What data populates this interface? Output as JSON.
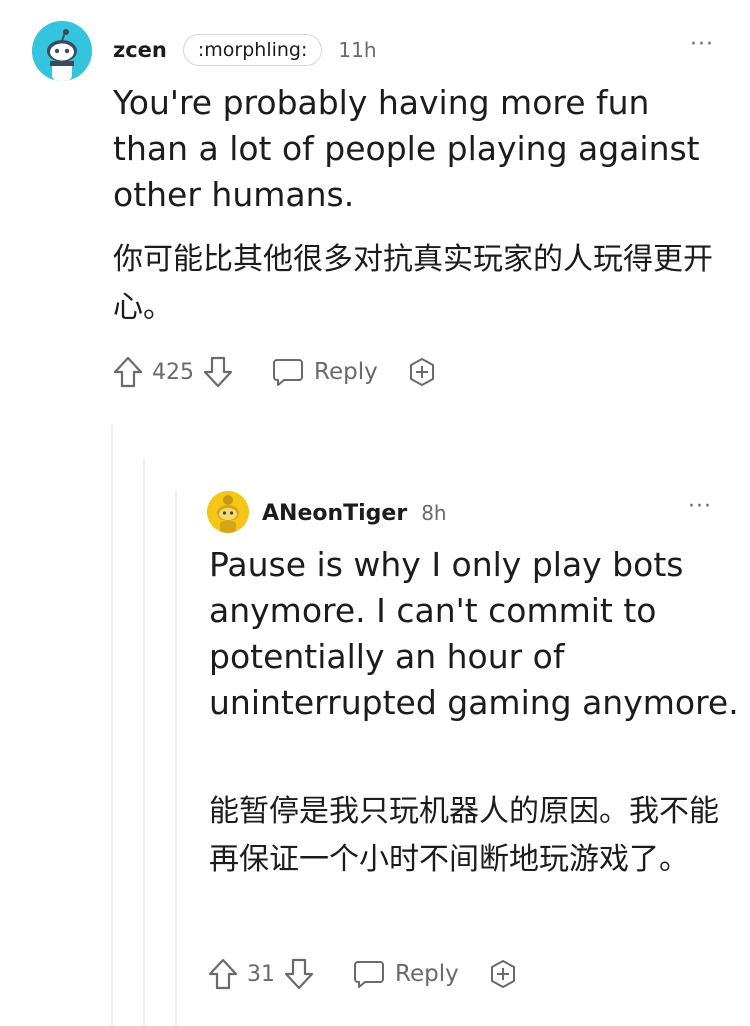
{
  "comments": [
    {
      "username": "zcen",
      "flair": ":morphling:",
      "time": "11h",
      "avatar_color": "#35c4de",
      "body": "You're probably having more fun than a lot of people playing against other humans.",
      "translation": "你可能比其他很多对抗真实玩家的人玩得更开心。",
      "votes": "425",
      "reply_label": "Reply",
      "more_label": "···"
    },
    {
      "username": "ANeonTiger",
      "time": "8h",
      "avatar_color": "#f5c518",
      "body": "Pause is why I only play bots anymore. I can't commit to potentially an hour of uninterrupted gaming anymore.",
      "translation": "能暂停是我只玩机器人的原因。我不能再保证一个小时不间断地玩游戏了。",
      "votes": "31",
      "reply_label": "Reply",
      "more_label": "···"
    }
  ],
  "icons": {
    "upvote": "arrow-up-icon",
    "downvote": "arrow-down-icon",
    "reply": "speech-bubble-icon",
    "award": "award-plus-icon",
    "more": "more-dots-icon",
    "avatar": "reddit-snoo-icon"
  },
  "colors": {
    "text": "#1c1c1c",
    "muted": "#6a6a6a",
    "thread_line": "#ededed"
  }
}
